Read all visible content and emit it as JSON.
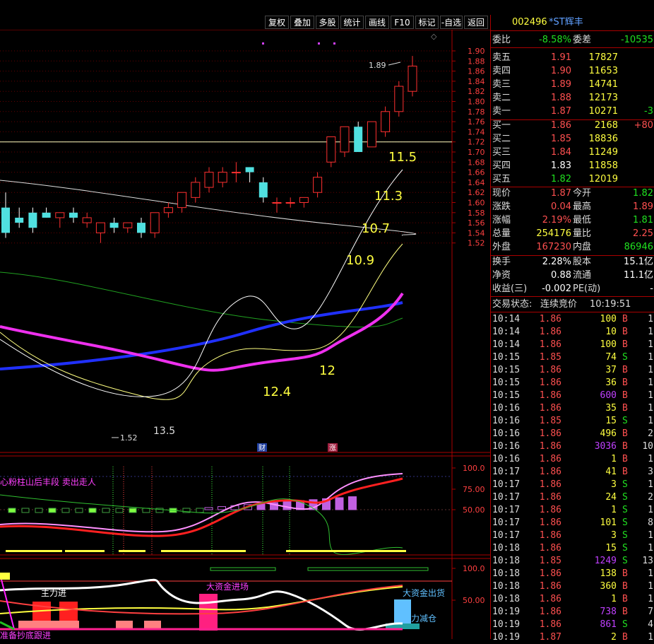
{
  "toolbar": {
    "buttons": [
      "复权",
      "叠加",
      "多股",
      "统计",
      "画线",
      "F10",
      "标记",
      "-自选",
      "返回"
    ]
  },
  "price_axis": {
    "labels": [
      "1.90",
      "1.88",
      "1.86",
      "1.84",
      "1.82",
      "1.80",
      "1.78",
      "1.76",
      "1.74",
      "1.72",
      "1.70",
      "1.68",
      "1.66",
      "1.64",
      "1.62",
      "1.60",
      "1.58",
      "1.56",
      "1.54",
      "1.52"
    ]
  },
  "indicator1": {
    "title": "心粉柱山后丰段  卖出走人",
    "axis_labels": [
      "100.0",
      "75.00",
      "50.00"
    ]
  },
  "indicator2": {
    "axis_labels": [
      "100.0",
      "50.00"
    ],
    "labels": {
      "main_in": "主力进",
      "big_in": "大资金进场",
      "big_out": "大资金出货",
      "reduce": "力减仓",
      "prepare": "准备抄底跟进"
    }
  },
  "annotations": {
    "high": "1.89",
    "low": "1.52",
    "n135": "13.5",
    "n124": "12.4",
    "n12": "12",
    "n109": "10.9",
    "n107": "10.7",
    "n113": "11.3",
    "n115": "11.5",
    "cai": "财",
    "zhang": "涨"
  },
  "quote": {
    "code": "002496",
    "name": "*ST辉丰",
    "weibi_label": "委比",
    "weibi": "-8.58%",
    "weicha_label": "委差",
    "weicha": "-10535",
    "asks": [
      {
        "label": "卖五",
        "price": "1.91",
        "vol": "17827",
        "chg": ""
      },
      {
        "label": "卖四",
        "price": "1.90",
        "vol": "11653",
        "chg": ""
      },
      {
        "label": "卖三",
        "price": "1.89",
        "vol": "14741",
        "chg": ""
      },
      {
        "label": "卖二",
        "price": "1.88",
        "vol": "12173",
        "chg": ""
      },
      {
        "label": "卖一",
        "price": "1.87",
        "vol": "10271",
        "chg": "-3"
      }
    ],
    "bids": [
      {
        "label": "买一",
        "price": "1.86",
        "vol": "2168",
        "chg": "+80"
      },
      {
        "label": "买二",
        "price": "1.85",
        "vol": "18836",
        "chg": ""
      },
      {
        "label": "买三",
        "price": "1.84",
        "vol": "11249",
        "chg": ""
      },
      {
        "label": "买四",
        "price": "1.83",
        "vol": "11858",
        "chg": ""
      },
      {
        "label": "买五",
        "price": "1.82",
        "vol": "12019",
        "chg": ""
      }
    ],
    "stats": [
      {
        "l1": "现价",
        "v1": "1.87",
        "l2": "今开",
        "v2": "1.82"
      },
      {
        "l1": "涨跌",
        "v1": "0.04",
        "l2": "最高",
        "v2": "1.89"
      },
      {
        "l1": "涨幅",
        "v1": "2.19%",
        "l2": "最低",
        "v2": "1.81"
      },
      {
        "l1": "总量",
        "v1": "254176",
        "l2": "量比",
        "v2": "2.25"
      },
      {
        "l1": "外盘",
        "v1": "167230",
        "l2": "内盘",
        "v2": "86946"
      }
    ],
    "stats2": [
      {
        "l1": "换手",
        "v1": "2.28%",
        "l2": "股本",
        "v2": "15.1亿"
      },
      {
        "l1": "净资",
        "v1": "0.88",
        "l2": "流通",
        "v2": "11.1亿"
      },
      {
        "l1": "收益(三)",
        "v1": "-0.002",
        "l2": "PE(动)",
        "v2": "-"
      }
    ],
    "status_label": "交易状态:",
    "status": "连续竞价",
    "status_time": "10:19:51",
    "ticks": [
      {
        "t": "10:14",
        "p": "1.86",
        "v": "100",
        "bs": "B",
        "n": "1"
      },
      {
        "t": "10:14",
        "p": "1.86",
        "v": "10",
        "bs": "B",
        "n": "1"
      },
      {
        "t": "10:14",
        "p": "1.86",
        "v": "100",
        "bs": "B",
        "n": "1"
      },
      {
        "t": "10:15",
        "p": "1.85",
        "v": "74",
        "bs": "S",
        "n": "1"
      },
      {
        "t": "10:15",
        "p": "1.86",
        "v": "37",
        "bs": "B",
        "n": "1"
      },
      {
        "t": "10:15",
        "p": "1.86",
        "v": "36",
        "bs": "B",
        "n": "1"
      },
      {
        "t": "10:15",
        "p": "1.86",
        "v": "600",
        "bs": "B",
        "n": "1"
      },
      {
        "t": "10:16",
        "p": "1.86",
        "v": "35",
        "bs": "B",
        "n": "1"
      },
      {
        "t": "10:16",
        "p": "1.85",
        "v": "15",
        "bs": "S",
        "n": "1"
      },
      {
        "t": "10:16",
        "p": "1.86",
        "v": "496",
        "bs": "B",
        "n": "2"
      },
      {
        "t": "10:16",
        "p": "1.86",
        "v": "3036",
        "bs": "B",
        "n": "10"
      },
      {
        "t": "10:16",
        "p": "1.86",
        "v": "1",
        "bs": "B",
        "n": "1"
      },
      {
        "t": "10:17",
        "p": "1.86",
        "v": "41",
        "bs": "B",
        "n": "3"
      },
      {
        "t": "10:17",
        "p": "1.86",
        "v": "3",
        "bs": "S",
        "n": "1"
      },
      {
        "t": "10:17",
        "p": "1.86",
        "v": "24",
        "bs": "S",
        "n": "2"
      },
      {
        "t": "10:17",
        "p": "1.86",
        "v": "1",
        "bs": "S",
        "n": "1"
      },
      {
        "t": "10:17",
        "p": "1.86",
        "v": "101",
        "bs": "S",
        "n": "8"
      },
      {
        "t": "10:17",
        "p": "1.86",
        "v": "3",
        "bs": "S",
        "n": "1"
      },
      {
        "t": "10:18",
        "p": "1.86",
        "v": "15",
        "bs": "S",
        "n": "1"
      },
      {
        "t": "10:18",
        "p": "1.85",
        "v": "1249",
        "bs": "S",
        "n": "13"
      },
      {
        "t": "10:18",
        "p": "1.86",
        "v": "138",
        "bs": "B",
        "n": "1"
      },
      {
        "t": "10:18",
        "p": "1.86",
        "v": "360",
        "bs": "B",
        "n": "1"
      },
      {
        "t": "10:18",
        "p": "1.86",
        "v": "1",
        "bs": "B",
        "n": "1"
      },
      {
        "t": "10:19",
        "p": "1.86",
        "v": "738",
        "bs": "B",
        "n": "7"
      },
      {
        "t": "10:19",
        "p": "1.86",
        "v": "861",
        "bs": "S",
        "n": "4"
      },
      {
        "t": "10:19",
        "p": "1.87",
        "v": "2",
        "bs": "B",
        "n": "1"
      }
    ]
  },
  "chart_data": {
    "type": "candlestick",
    "series": [
      {
        "o": 1.59,
        "h": 1.62,
        "l": 1.53,
        "c": 1.54
      },
      {
        "o": 1.57,
        "h": 1.59,
        "l": 1.55,
        "c": 1.56
      },
      {
        "o": 1.58,
        "h": 1.59,
        "l": 1.54,
        "c": 1.55
      },
      {
        "o": 1.58,
        "h": 1.59,
        "l": 1.57,
        "c": 1.57
      },
      {
        "o": 1.57,
        "h": 1.58,
        "l": 1.55,
        "c": 1.58
      },
      {
        "o": 1.58,
        "h": 1.59,
        "l": 1.56,
        "c": 1.57
      },
      {
        "o": 1.56,
        "h": 1.58,
        "l": 1.55,
        "c": 1.57
      },
      {
        "o": 1.54,
        "h": 1.56,
        "l": 1.52,
        "c": 1.56
      },
      {
        "o": 1.56,
        "h": 1.57,
        "l": 1.54,
        "c": 1.55
      },
      {
        "o": 1.55,
        "h": 1.56,
        "l": 1.54,
        "c": 1.56
      },
      {
        "o": 1.56,
        "h": 1.57,
        "l": 1.53,
        "c": 1.54
      },
      {
        "o": 1.54,
        "h": 1.58,
        "l": 1.53,
        "c": 1.58
      },
      {
        "o": 1.58,
        "h": 1.6,
        "l": 1.57,
        "c": 1.59
      },
      {
        "o": 1.59,
        "h": 1.62,
        "l": 1.58,
        "c": 1.62
      },
      {
        "o": 1.61,
        "h": 1.65,
        "l": 1.6,
        "c": 1.64
      },
      {
        "o": 1.63,
        "h": 1.67,
        "l": 1.62,
        "c": 1.66
      },
      {
        "o": 1.64,
        "h": 1.67,
        "l": 1.63,
        "c": 1.66
      },
      {
        "o": 1.66,
        "h": 1.68,
        "l": 1.64,
        "c": 1.66
      },
      {
        "o": 1.67,
        "h": 1.67,
        "l": 1.64,
        "c": 1.66
      },
      {
        "o": 1.64,
        "h": 1.65,
        "l": 1.6,
        "c": 1.61
      },
      {
        "o": 1.6,
        "h": 1.61,
        "l": 1.58,
        "c": 1.6
      },
      {
        "o": 1.6,
        "h": 1.61,
        "l": 1.59,
        "c": 1.6
      },
      {
        "o": 1.6,
        "h": 1.61,
        "l": 1.59,
        "c": 1.61
      },
      {
        "o": 1.62,
        "h": 1.66,
        "l": 1.61,
        "c": 1.65
      },
      {
        "o": 1.68,
        "h": 1.73,
        "l": 1.67,
        "c": 1.73
      },
      {
        "o": 1.7,
        "h": 1.75,
        "l": 1.69,
        "c": 1.75
      },
      {
        "o": 1.75,
        "h": 1.76,
        "l": 1.7,
        "c": 1.7
      },
      {
        "o": 1.71,
        "h": 1.76,
        "l": 1.71,
        "c": 1.76
      },
      {
        "o": 1.74,
        "h": 1.79,
        "l": 1.73,
        "c": 1.78
      },
      {
        "o": 1.78,
        "h": 1.84,
        "l": 1.77,
        "c": 1.83
      },
      {
        "o": 1.82,
        "h": 1.89,
        "l": 1.81,
        "c": 1.87
      }
    ],
    "ylim": [
      1.51,
      1.91
    ]
  }
}
